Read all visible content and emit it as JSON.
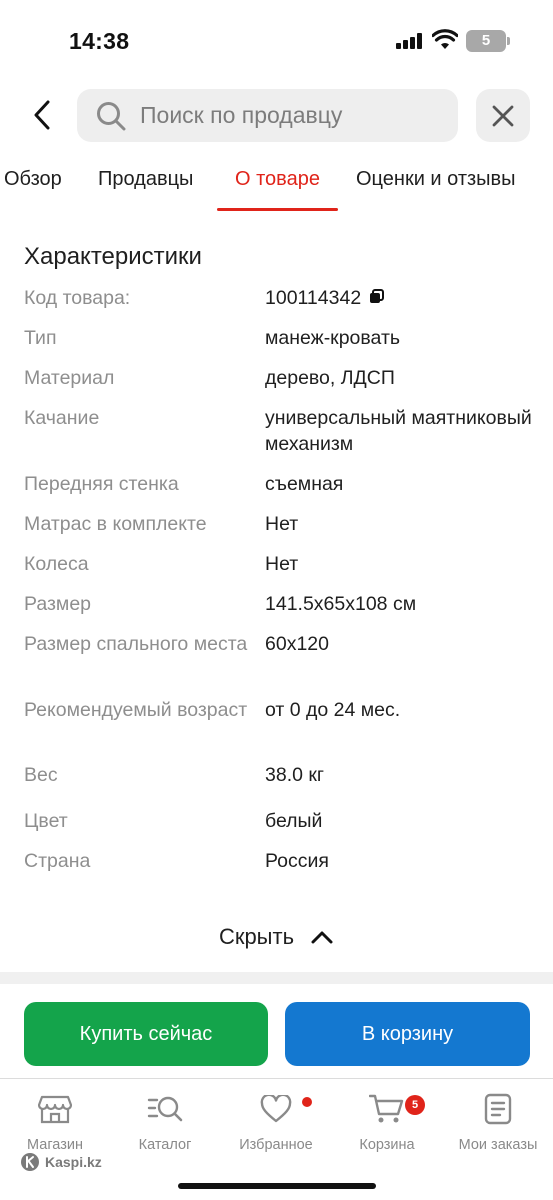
{
  "status_bar": {
    "time": "14:38",
    "battery": "5"
  },
  "search": {
    "placeholder": "Поиск по продавцу"
  },
  "tabs": [
    {
      "label": "Обзор"
    },
    {
      "label": "Продавцы"
    },
    {
      "label": "О товаре",
      "active": true
    },
    {
      "label": "Оценки и отзывы"
    }
  ],
  "specs": {
    "title": "Характеристики",
    "rows": [
      {
        "label": "Код товара:",
        "value": "100114342"
      },
      {
        "label": "Тип",
        "value": "манеж-кровать"
      },
      {
        "label": "Материал",
        "value": "дерево, ЛДСП"
      },
      {
        "label": "Качание",
        "value": "универсальный маятниковый механизм"
      },
      {
        "label": "Передняя стенка",
        "value": "съемная"
      },
      {
        "label": "Матрас в комплекте",
        "value": "Нет"
      },
      {
        "label": "Колеса",
        "value": "Нет"
      },
      {
        "label": "Размер",
        "value": "141.5x65x108 см"
      },
      {
        "label": "Размер спального места",
        "value": "60x120"
      },
      {
        "label": "Рекомендуемый возраст",
        "value": "от 0 до 24 мес."
      },
      {
        "label": "Вес",
        "value": "38.0 кг"
      },
      {
        "label": "Цвет",
        "value": "белый"
      },
      {
        "label": "Страна",
        "value": "Россия"
      }
    ],
    "hide_label": "Скрыть"
  },
  "actions": {
    "buy_now": "Купить сейчас",
    "to_cart": "В корзину"
  },
  "bottom_nav": {
    "items": [
      {
        "label": "Магазин",
        "icon": "store-icon"
      },
      {
        "label": "Каталог",
        "icon": "catalog-search-icon"
      },
      {
        "label": "Избранное",
        "icon": "heart-icon"
      },
      {
        "label": "Корзина",
        "icon": "cart-icon",
        "badge": "5"
      },
      {
        "label": "Мои заказы",
        "icon": "orders-icon"
      }
    ]
  },
  "brand": {
    "logo_text": "Kaspi.kz"
  },
  "colors": {
    "accent_red": "#e0241a",
    "buy_green": "#14a44b",
    "cart_blue": "#1478d0"
  }
}
